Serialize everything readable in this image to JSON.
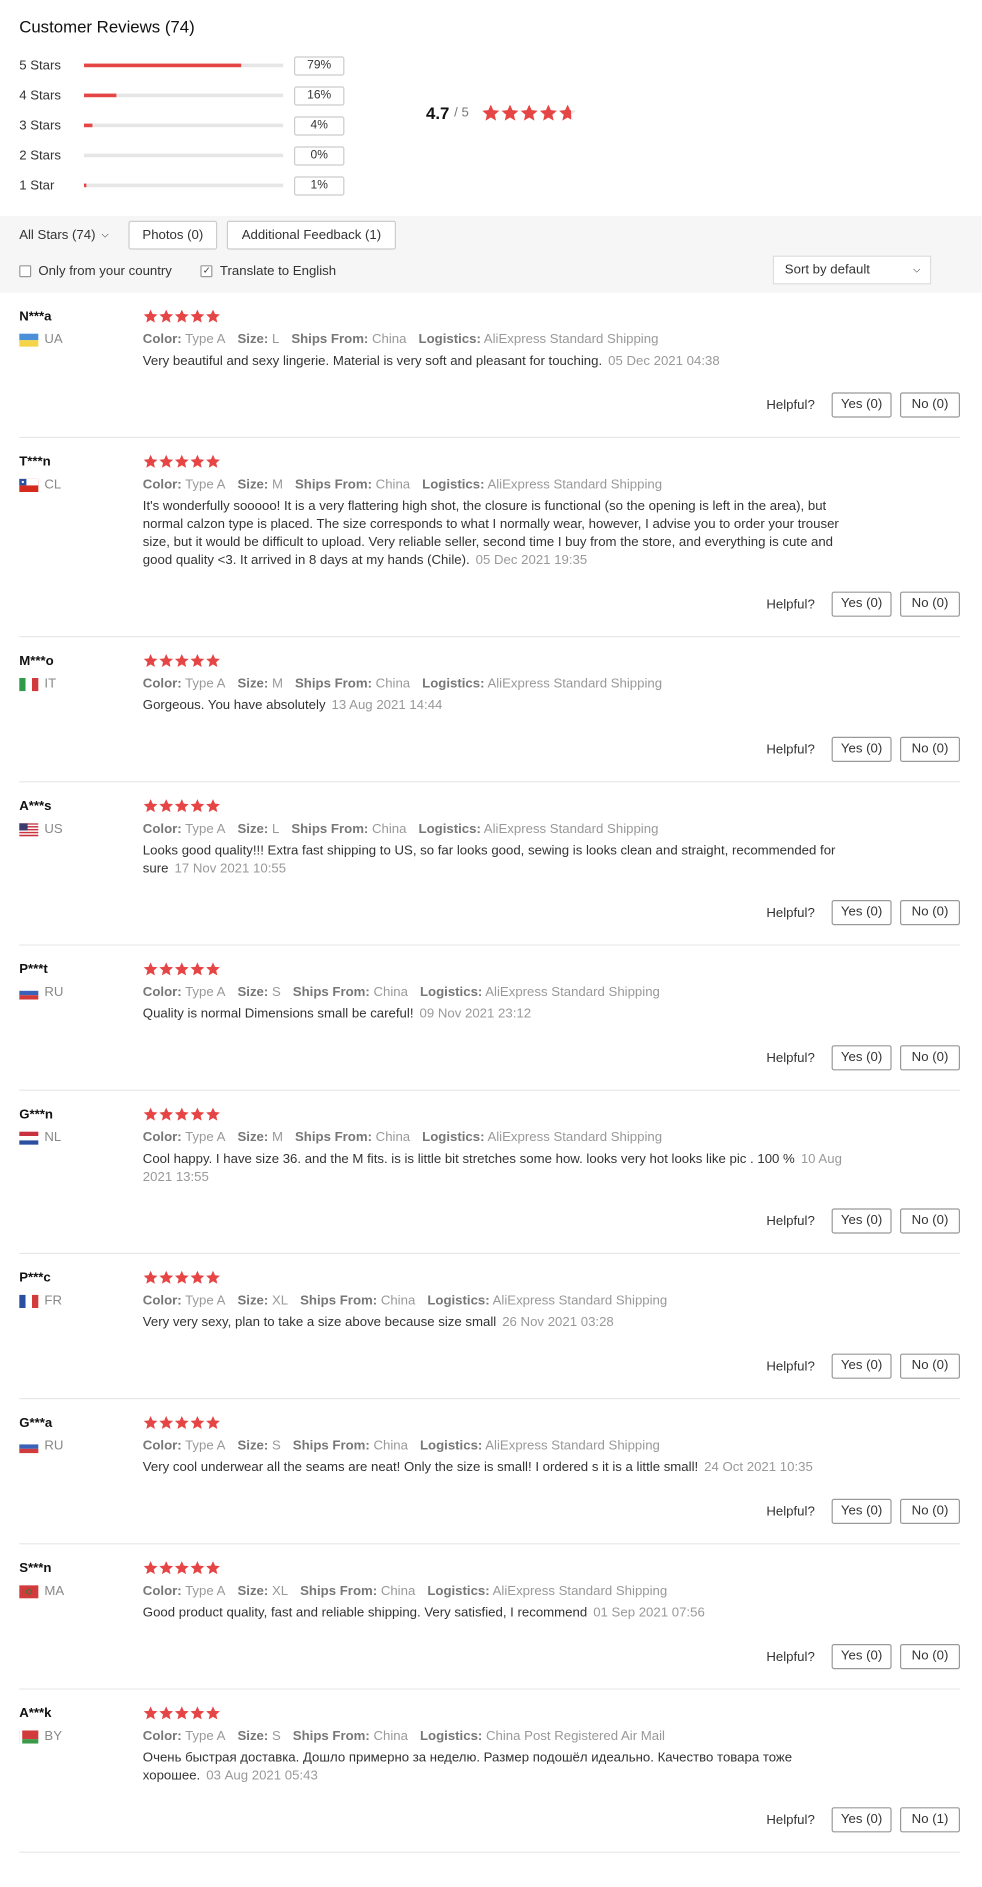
{
  "header": {
    "title": "Customer Reviews (74)"
  },
  "distribution": [
    {
      "label": "5 Stars",
      "percent": "79%",
      "fraction": 0.79
    },
    {
      "label": "4 Stars",
      "percent": "16%",
      "fraction": 0.16
    },
    {
      "label": "3 Stars",
      "percent": "4%",
      "fraction": 0.04
    },
    {
      "label": "2 Stars",
      "percent": "0%",
      "fraction": 0.0
    },
    {
      "label": "1 Star",
      "percent": "1%",
      "fraction": 0.01
    }
  ],
  "average": {
    "value": "4.7",
    "out_of": "/ 5",
    "rating": 4.7
  },
  "filters": {
    "all_stars": "All Stars (74)",
    "photos": "Photos (0)",
    "additional_feedback": "Additional Feedback (1)",
    "only_country": "Only from your country",
    "only_country_checked": false,
    "translate": "Translate to English",
    "translate_checked": true,
    "sort": "Sort by default"
  },
  "labels": {
    "color": "Color:",
    "size": "Size:",
    "ships_from": "Ships From:",
    "logistics": "Logistics:",
    "helpful": "Helpful?"
  },
  "colors": {
    "accent": "#e64545",
    "bar_track": "#e6e6e6"
  },
  "reviews": [
    {
      "name": "N***a",
      "country": "UA",
      "flag": "ua",
      "stars": 5,
      "color": "Type A",
      "size": "L",
      "ships_from": "China",
      "logistics": "AliExpress Standard Shipping",
      "text": "Very beautiful and sexy lingerie. Material is very soft and pleasant for touching.",
      "date": "05 Dec 2021 04:38",
      "yes": "Yes (0)",
      "no": "No (0)"
    },
    {
      "name": "T***n",
      "country": "CL",
      "flag": "cl",
      "stars": 5,
      "color": "Type A",
      "size": "M",
      "ships_from": "China",
      "logistics": "AliExpress Standard Shipping",
      "text": "It's wonderfully sooooo! It is a very flattering high shot, the closure is functional (so the opening is left in the area), but normal calzon type is placed. The size corresponds to what I normally wear, however, I advise you to order your trouser size, but it would be difficult to upload. Very reliable seller, second time I buy from the store, and everything is cute and good quality <3. It arrived in 8 days at my hands (Chile).",
      "date": "05 Dec 2021 19:35",
      "yes": "Yes (0)",
      "no": "No (0)"
    },
    {
      "name": "M***o",
      "country": "IT",
      "flag": "it",
      "stars": 5,
      "color": "Type A",
      "size": "M",
      "ships_from": "China",
      "logistics": "AliExpress Standard Shipping",
      "text": "Gorgeous. You have absolutely",
      "date": "13 Aug 2021 14:44",
      "yes": "Yes (0)",
      "no": "No (0)"
    },
    {
      "name": "A***s",
      "country": "US",
      "flag": "us",
      "stars": 5,
      "color": "Type A",
      "size": "L",
      "ships_from": "China",
      "logistics": "AliExpress Standard Shipping",
      "text": "Looks good quality!!! Extra fast shipping to US, so far looks good, sewing is looks clean and straight, recommended for sure",
      "date": "17 Nov 2021 10:55",
      "yes": "Yes (0)",
      "no": "No (0)"
    },
    {
      "name": "P***t",
      "country": "RU",
      "flag": "ru",
      "stars": 5,
      "color": "Type A",
      "size": "S",
      "ships_from": "China",
      "logistics": "AliExpress Standard Shipping",
      "text": "Quality is normal Dimensions small be careful!",
      "date": "09 Nov 2021 23:12",
      "yes": "Yes (0)",
      "no": "No (0)"
    },
    {
      "name": "G***n",
      "country": "NL",
      "flag": "nl",
      "stars": 5,
      "color": "Type A",
      "size": "M",
      "ships_from": "China",
      "logistics": "AliExpress Standard Shipping",
      "text": "Cool happy. I have size 36. and the M fits. is is little bit stretches some how. looks very hot looks like pic . 100 %",
      "date": "10 Aug 2021 13:55",
      "yes": "Yes (0)",
      "no": "No (0)"
    },
    {
      "name": "P***c",
      "country": "FR",
      "flag": "fr",
      "stars": 5,
      "color": "Type A",
      "size": "XL",
      "ships_from": "China",
      "logistics": "AliExpress Standard Shipping",
      "text": "Very very sexy, plan to take a size above because size small",
      "date": "26 Nov 2021 03:28",
      "yes": "Yes (0)",
      "no": "No (0)"
    },
    {
      "name": "G***a",
      "country": "RU",
      "flag": "ru",
      "stars": 5,
      "color": "Type A",
      "size": "S",
      "ships_from": "China",
      "logistics": "AliExpress Standard Shipping",
      "text": "Very cool underwear all the seams are neat! Only the size is small! I ordered s it is a little small!",
      "date": "24 Oct 2021 10:35",
      "yes": "Yes (0)",
      "no": "No (0)"
    },
    {
      "name": "S***n",
      "country": "MA",
      "flag": "ma",
      "stars": 5,
      "color": "Type A",
      "size": "XL",
      "ships_from": "China",
      "logistics": "AliExpress Standard Shipping",
      "text": "Good product quality, fast and reliable shipping. Very satisfied, I recommend",
      "date": "01 Sep 2021 07:56",
      "yes": "Yes (0)",
      "no": "No (0)"
    },
    {
      "name": "A***k",
      "country": "BY",
      "flag": "by",
      "stars": 5,
      "color": "Type A",
      "size": "S",
      "ships_from": "China",
      "logistics": "China Post Registered Air Mail",
      "text": "Очень быстрая доставка. Дошло примерно за неделю. Размер подошёл идеально. Качество товара тоже хорошее.",
      "date": "03 Aug 2021 05:43",
      "yes": "Yes (0)",
      "no": "No (1)"
    }
  ]
}
